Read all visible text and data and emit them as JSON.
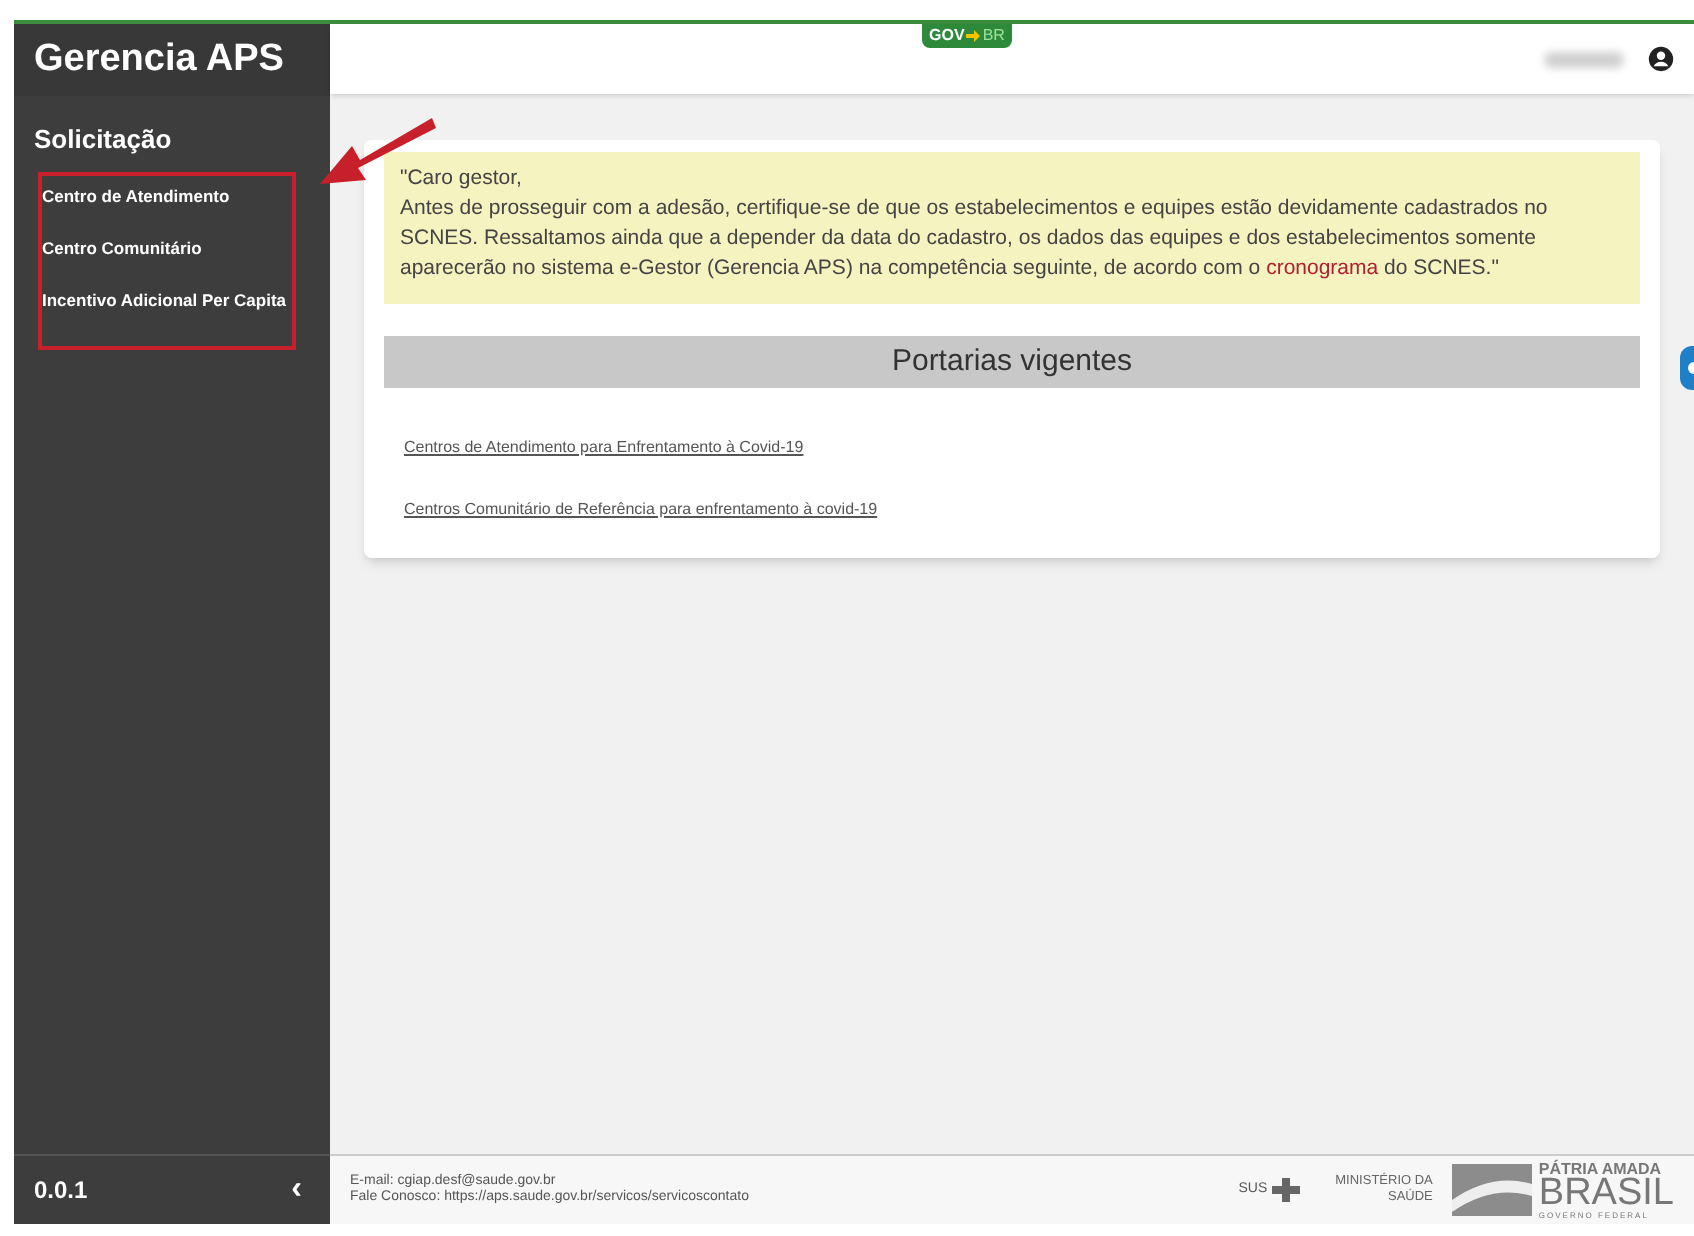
{
  "sidebar": {
    "logo": "Gerencia APS",
    "section": "Solicitação",
    "items": [
      {
        "label": "Centro de Atendimento"
      },
      {
        "label": "Centro Comunitário"
      },
      {
        "label": "Incentivo Adicional Per Capita"
      }
    ],
    "version": "0.0.1",
    "collapse": "‹"
  },
  "header": {
    "badge_left": "GOV",
    "badge_right": "BR"
  },
  "notice": {
    "parts": [
      "\"Caro gestor,",
      "Antes de prosseguir com a adesão, certifique-se de que os estabelecimentos e equipes estão devidamente cadastrados no SCNES. Ressaltamos ainda que a depender da data do cadastro, os dados das equipes e dos estabelecimentos somente aparecerão no sistema e-Gestor (Gerencia APS) na competência seguinte, de acordo com o "
    ],
    "link": "cronograma",
    "tail": " do SCNES.\""
  },
  "portarias": {
    "title": "Portarias vigentes",
    "links": [
      "Centros de Atendimento para Enfrentamento à Covid-19",
      "Centros Comunitário de Referência para enfrentamento à covid-19"
    ]
  },
  "footer": {
    "email": "E-mail: cgiap.desf@saude.gov.br",
    "contact": "Fale Conosco: https://aps.saude.gov.br/servicos/servicoscontato",
    "sus": "SUS",
    "ministry": [
      "MINISTÉRIO DA",
      "SAÚDE"
    ],
    "brasil": [
      "PÁTRIA AMADA",
      "BRASIL",
      "GOVERNO FEDERAL"
    ]
  }
}
